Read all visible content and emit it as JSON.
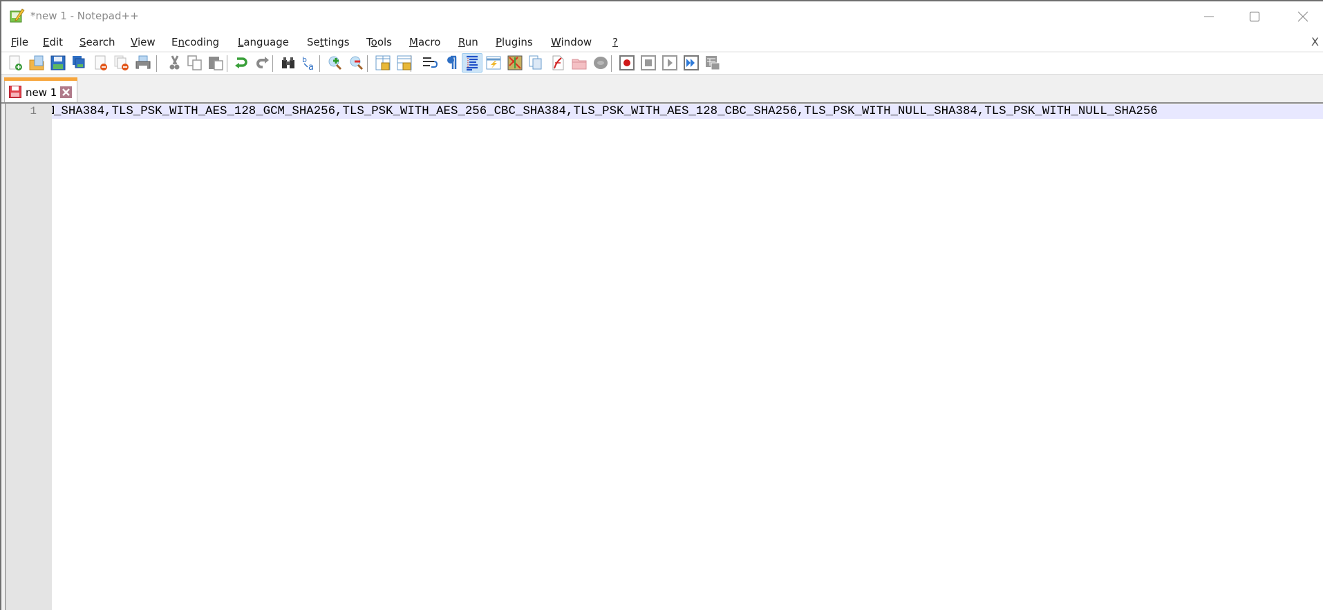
{
  "window": {
    "title": "*new 1 - Notepad++",
    "controls": {
      "minimize": "minimize-icon",
      "maximize": "maximize-icon",
      "close": "close-icon"
    }
  },
  "menu": {
    "items": [
      {
        "label": "File",
        "mnemonic": "F"
      },
      {
        "label": "Edit",
        "mnemonic": "E"
      },
      {
        "label": "Search",
        "mnemonic": "S"
      },
      {
        "label": "View",
        "mnemonic": "V"
      },
      {
        "label": "Encoding",
        "mnemonic": "n"
      },
      {
        "label": "Language",
        "mnemonic": "L"
      },
      {
        "label": "Settings",
        "mnemonic": "t"
      },
      {
        "label": "Tools",
        "mnemonic": "o"
      },
      {
        "label": "Macro",
        "mnemonic": "M"
      },
      {
        "label": "Run",
        "mnemonic": "R"
      },
      {
        "label": "Plugins",
        "mnemonic": "P"
      },
      {
        "label": "Window",
        "mnemonic": "W"
      },
      {
        "label": "?",
        "mnemonic": "?"
      }
    ],
    "doc_close": "X"
  },
  "toolbar": {
    "buttons": [
      "new-file",
      "open-file",
      "save",
      "save-all",
      "close",
      "close-all",
      "print",
      "cut",
      "copy",
      "paste",
      "undo",
      "redo",
      "find",
      "replace",
      "zoom-in",
      "zoom-out",
      "sync-vertical-scroll",
      "sync-horizontal-scroll",
      "word-wrap",
      "show-all-characters",
      "indent-guide",
      "user-defined-language",
      "document-map",
      "document-list",
      "function-list",
      "folder-as-workspace",
      "monitoring",
      "start-recording",
      "stop-recording",
      "playback-macro",
      "run-macro-multiple",
      "save-macro"
    ],
    "active": "indent-guide"
  },
  "tabs": [
    {
      "label": "new 1",
      "modified": true,
      "active": true
    }
  ],
  "editor": {
    "lines": [
      {
        "number": "1",
        "text": "_SHA384,TLS_PSK_WITH_AES_128_GCM_SHA256,TLS_PSK_WITH_AES_256_CBC_SHA384,TLS_PSK_WITH_AES_128_CBC_SHA256,TLS_PSK_WITH_NULL_SHA384,TLS_PSK_WITH_NULL_SHA256",
        "clipped_lead": "I"
      }
    ]
  },
  "colors": {
    "tab_accent": "#f7a63d",
    "current_line": "#e8e8ff",
    "gutter": "#e4e4e4"
  }
}
